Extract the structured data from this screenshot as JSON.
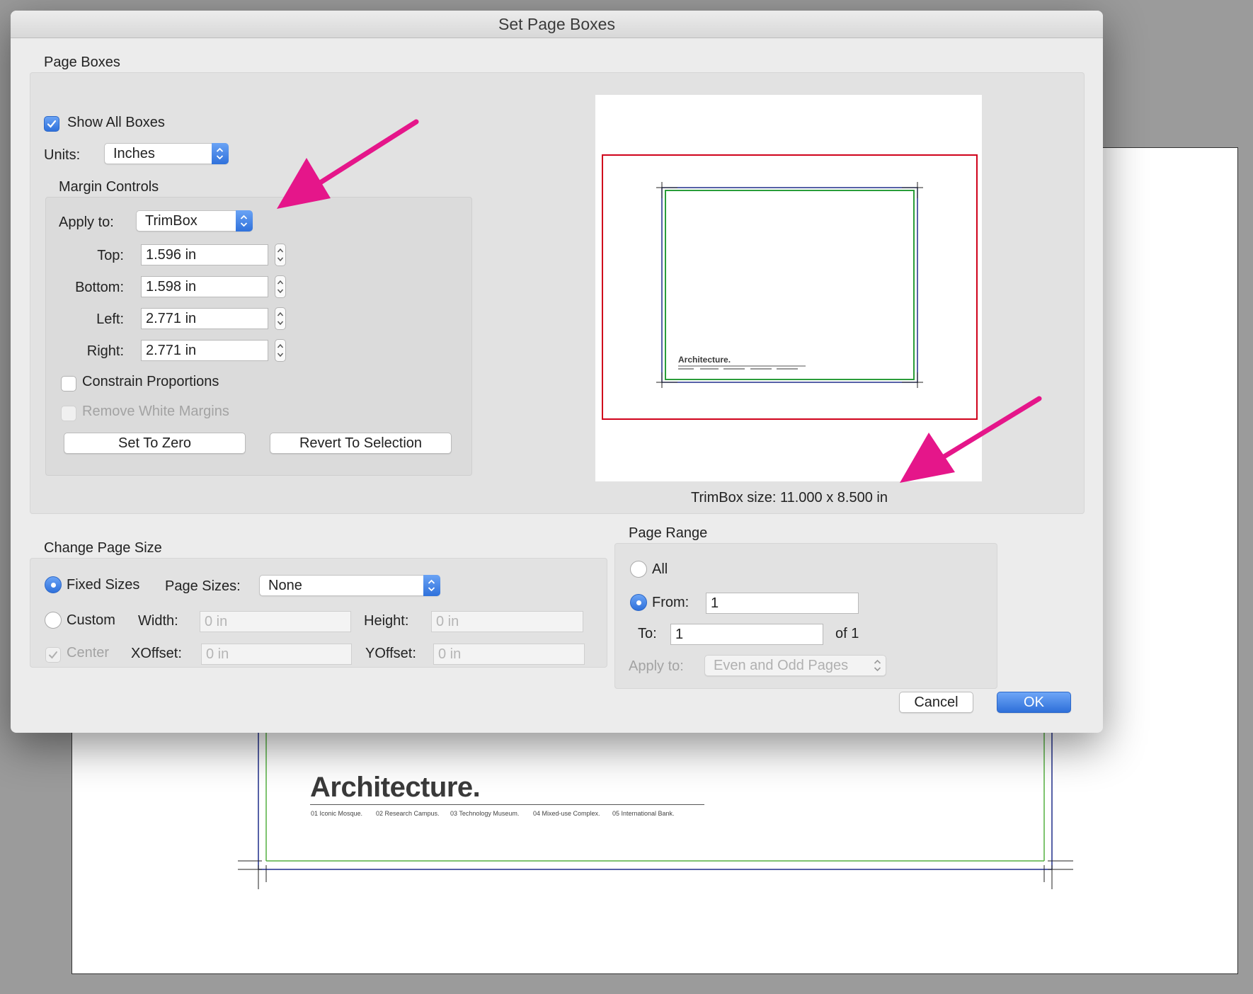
{
  "dialog": {
    "title": "Set Page Boxes",
    "ok_label": "OK",
    "cancel_label": "Cancel"
  },
  "page_boxes": {
    "group_label": "Page Boxes",
    "show_all_boxes_label": "Show All Boxes",
    "show_all_boxes_checked": true,
    "units_label": "Units:",
    "units_value": "Inches",
    "trimbox_size_text": "TrimBox size: 11.000 x 8.500 in",
    "preview_title": "Architecture."
  },
  "margin_controls": {
    "group_label": "Margin Controls",
    "apply_to_label": "Apply to:",
    "apply_to_value": "TrimBox",
    "top_label": "Top:",
    "top_value": "1.596 in",
    "bottom_label": "Bottom:",
    "bottom_value": "1.598 in",
    "left_label": "Left:",
    "left_value": "2.771 in",
    "right_label": "Right:",
    "right_value": "2.771 in",
    "constrain_label": "Constrain Proportions",
    "remove_white_label": "Remove White Margins",
    "set_to_zero_label": "Set To Zero",
    "revert_label": "Revert To Selection"
  },
  "change_page_size": {
    "group_label": "Change Page Size",
    "fixed_sizes_label": "Fixed Sizes",
    "page_sizes_label": "Page Sizes:",
    "page_sizes_value": "None",
    "custom_label": "Custom",
    "width_label": "Width:",
    "width_placeholder": "0 in",
    "height_label": "Height:",
    "height_placeholder": "0 in",
    "center_label": "Center",
    "xoffset_label": "XOffset:",
    "xoffset_placeholder": "0 in",
    "yoffset_label": "YOffset:",
    "yoffset_placeholder": "0 in"
  },
  "page_range": {
    "group_label": "Page Range",
    "all_label": "All",
    "from_label": "From:",
    "from_value": "1",
    "to_label": "To:",
    "to_value": "1",
    "of_label": "of 1",
    "apply_to_label": "Apply to:",
    "apply_to_value": "Even and Odd Pages"
  },
  "background_document": {
    "title": "Architecture.",
    "items": [
      "01 Iconic Mosque.",
      "02 Research Campus.",
      "03 Technology Museum.",
      "04 Mixed-use Complex.",
      "05 International Bank."
    ]
  },
  "colors": {
    "accent": "#2f71db",
    "annotation_arrow": "#e5168a",
    "mediabox": "#d0021b",
    "trimbox": "#2a9d3a",
    "bleedbox": "#1f2d8a"
  }
}
